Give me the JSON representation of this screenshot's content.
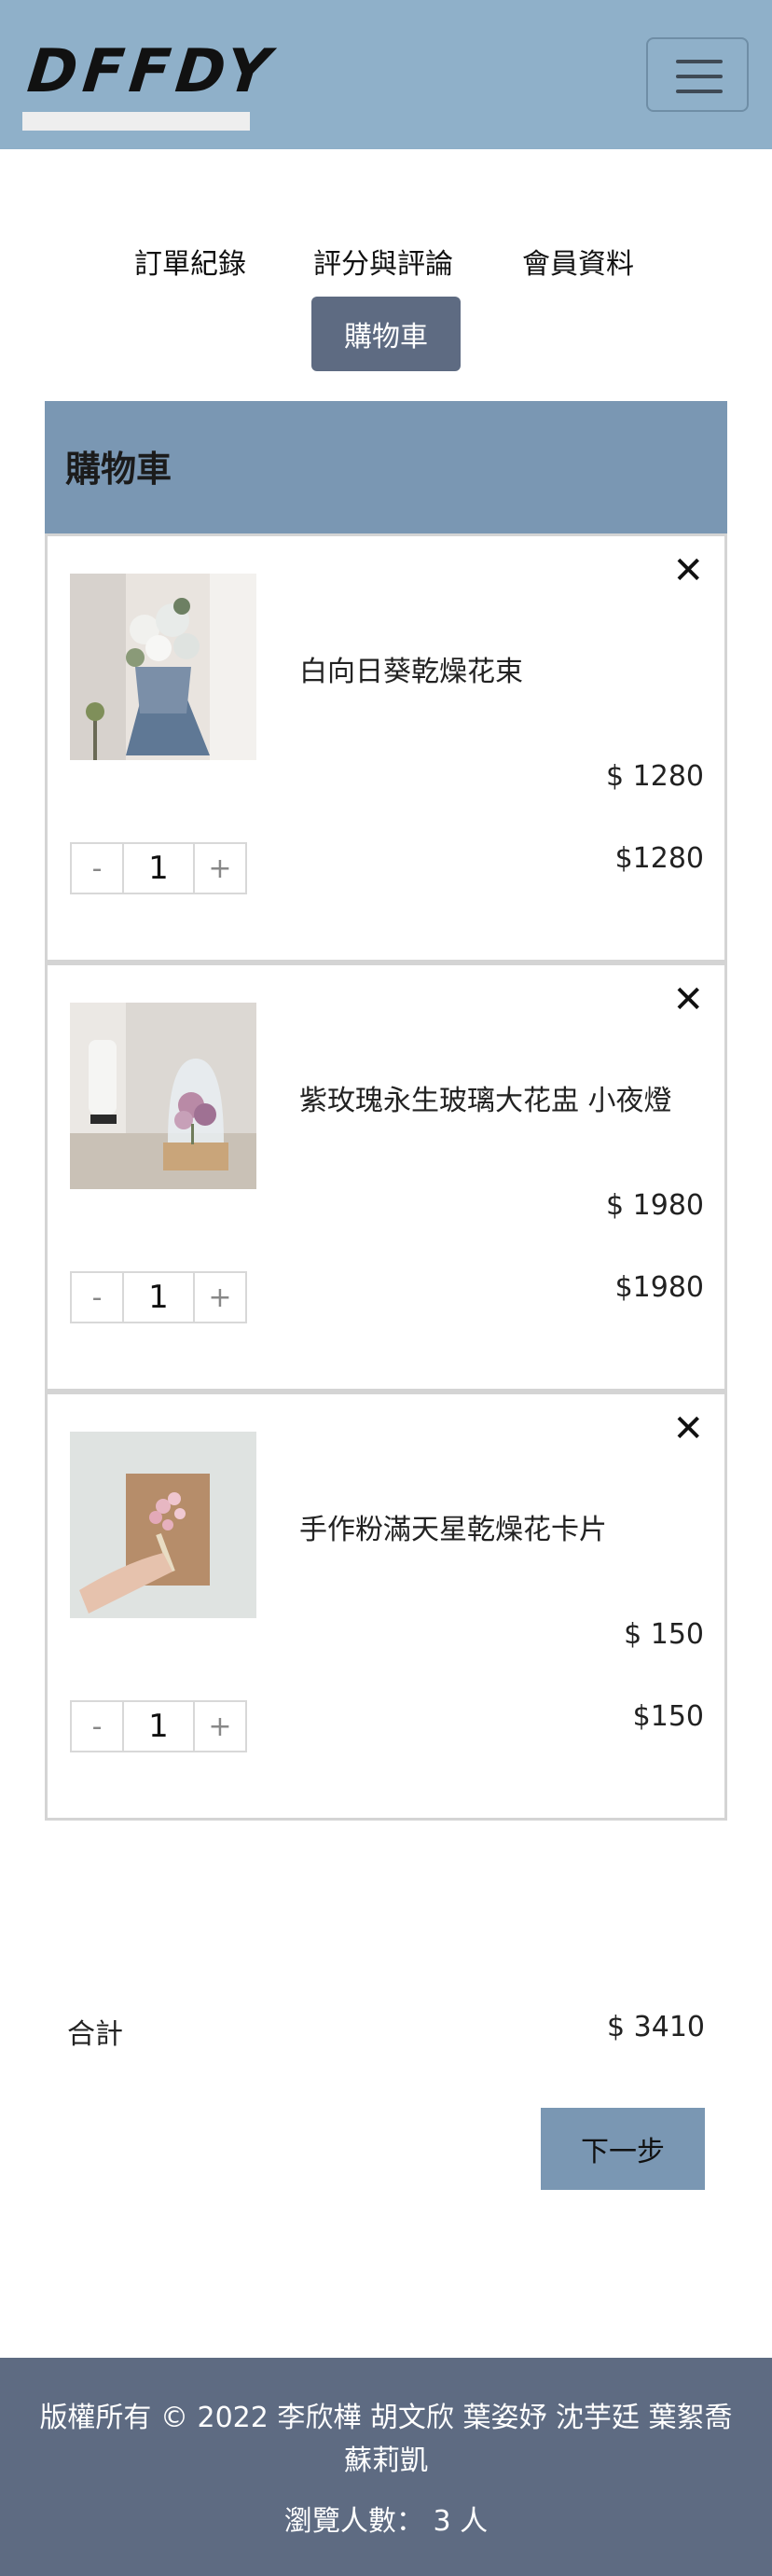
{
  "header": {
    "logo_text": "DFFDY",
    "menu_icon": "hamburger-icon"
  },
  "nav": {
    "links": [
      "訂單紀錄",
      "評分與評論",
      "會員資料"
    ],
    "active": "購物車"
  },
  "cart": {
    "title": "購物車",
    "remove_icon": "close-icon",
    "remove_symbol": "✕",
    "minus_symbol": "-",
    "plus_symbol": "+",
    "items": [
      {
        "name": "白向日葵乾燥花束",
        "price": "$ 1280",
        "quantity": "1",
        "subtotal": "$1280"
      },
      {
        "name": "紫玫瑰永生玻璃大花盅 小夜燈",
        "price": "$ 1980",
        "quantity": "1",
        "subtotal": "$1980"
      },
      {
        "name": "手作粉滿天星乾燥花卡片",
        "price": "$ 150",
        "quantity": "1",
        "subtotal": "$150"
      }
    ],
    "total_label": "合計",
    "total_value": "$ 3410",
    "next_button": "下一步"
  },
  "footer": {
    "copyright": "版權所有 © 2022 李欣樺 胡文欣 葉姿妤 沈芋廷 葉絮喬 蘇莉凱",
    "views": "瀏覽人數： 3 人"
  },
  "colors": {
    "header_bg": "#8fb0c9",
    "accent": "#7a97b3",
    "dark": "#5e6b82"
  }
}
